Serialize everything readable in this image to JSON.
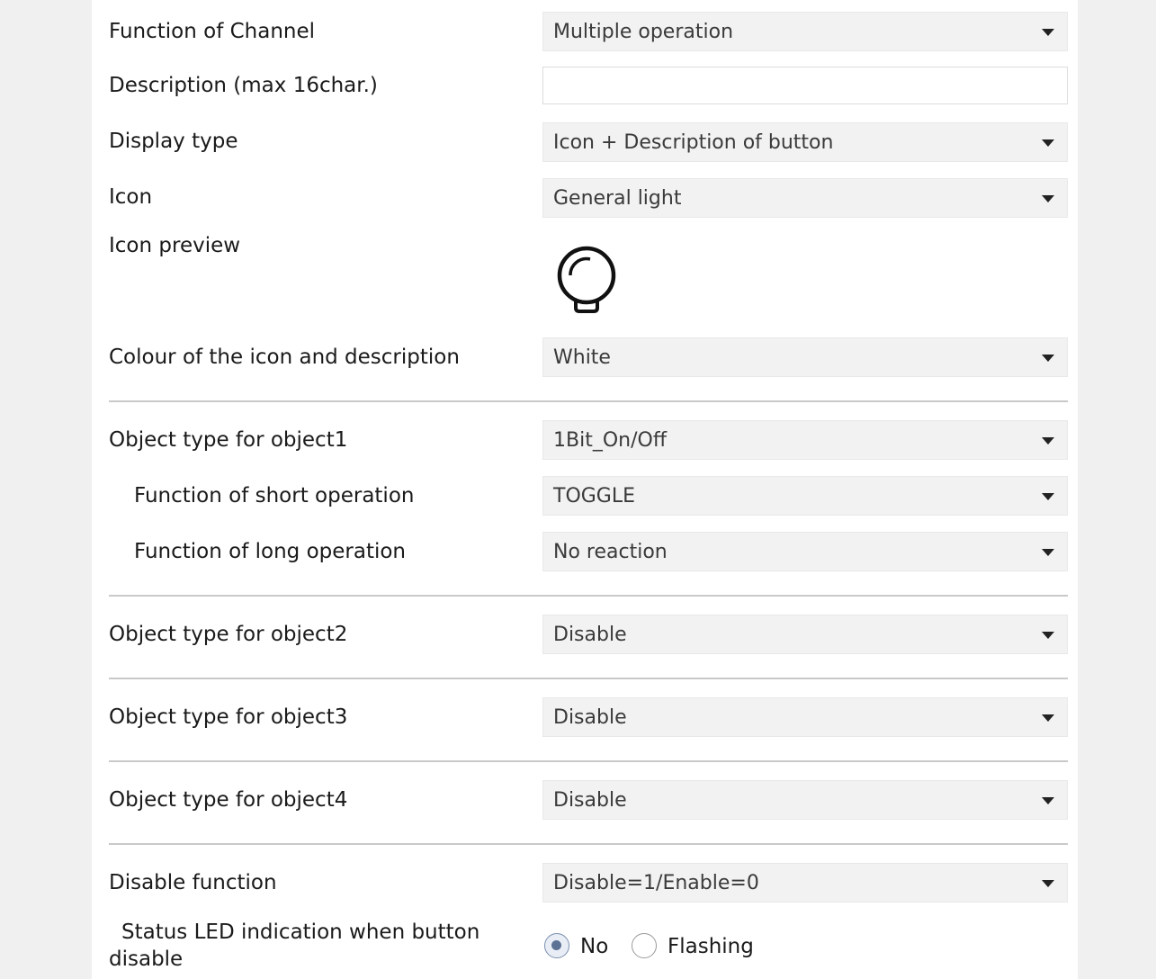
{
  "fields": {
    "function_of_channel": {
      "label": "Function of Channel",
      "value": "Multiple operation"
    },
    "description": {
      "label": "Description (max 16char.)",
      "value": ""
    },
    "display_type": {
      "label": "Display type",
      "value": "Icon + Description of button"
    },
    "icon": {
      "label": "Icon",
      "value": "General light"
    },
    "icon_preview": {
      "label": "Icon preview",
      "icon_name": "light-bulb-icon"
    },
    "colour": {
      "label": "Colour of the icon and description",
      "value": "White"
    },
    "object1_type": {
      "label": "Object type for object1",
      "value": "1Bit_On/Off"
    },
    "short_operation": {
      "label": "Function of short operation",
      "value": "TOGGLE"
    },
    "long_operation": {
      "label": "Function of long operation",
      "value": "No reaction"
    },
    "object2_type": {
      "label": "Object type for object2",
      "value": "Disable"
    },
    "object3_type": {
      "label": "Object type for object3",
      "value": "Disable"
    },
    "object4_type": {
      "label": "Object type for object4",
      "value": "Disable"
    },
    "disable_function": {
      "label": "Disable function",
      "value": "Disable=1/Enable=0"
    },
    "status_led": {
      "label": "Status LED indication when button disable",
      "options": [
        "No",
        "Flashing"
      ],
      "selected": "No"
    }
  },
  "colors": {
    "page_background": "#f0f0f0",
    "panel_background": "#ffffff",
    "select_background": "#f2f2f2",
    "divider": "#c9c9c9"
  }
}
